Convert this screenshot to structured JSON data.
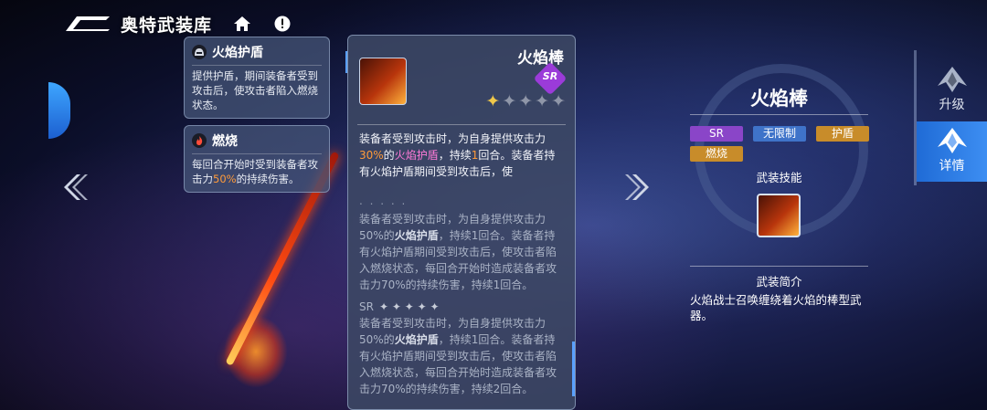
{
  "header": {
    "title": "奥特武装库"
  },
  "skills": [
    {
      "name": "火焰护盾",
      "icon": "helmet-icon",
      "desc": "提供护盾，期间装备者受到攻击后，使攻击者陷入燃烧状态。"
    },
    {
      "name": "燃烧",
      "icon": "flame-icon",
      "desc_pre": "每回合开始时受到装备者攻击力",
      "desc_pct": "50%",
      "desc_post": "的持续伤害。"
    }
  ],
  "weapon": {
    "name": "火焰棒",
    "rarity": "SR",
    "stars_total": 5,
    "stars_filled": 1,
    "effect": {
      "p1": "装备者受到攻击时，为自身提供攻击力",
      "pct": "30%",
      "p2": "的",
      "shield": "火焰护盾",
      "p3": "，持续",
      "turns": "1",
      "p4": "回合。装备者持有火焰护盾期间受到攻击后，使"
    },
    "dots": ". . . . .",
    "sub_effect_1_a": "装备者受到攻击时，为自身提供攻击力50%的",
    "sub_effect_1_b": "火焰护盾",
    "sub_effect_1_c": "，持续1回合。装备者持有火焰护盾期间受到攻击后，使攻击者陷入燃烧状态，每回合开始时造成装备者攻击力70%的持续伤害，持续1回合。",
    "sr_label": "SR",
    "sub_effect_2_a": "装备者受到攻击时，为自身提供攻击力50%的",
    "sub_effect_2_b": "火焰护盾",
    "sub_effect_2_c": "，持续1回合。装备者持有火焰护盾期间受到攻击后，使攻击者陷入燃烧状态，每回合开始时造成装备者攻击力70%的持续伤害，持续2回合。"
  },
  "detail": {
    "title": "火焰棒",
    "tags": [
      {
        "label": "SR",
        "color": "#8a45c8"
      },
      {
        "label": "无限制",
        "color": "#3f73c9"
      },
      {
        "label": "护盾",
        "color": "#c88c2a"
      },
      {
        "label": "燃烧",
        "color": "#c88c2a"
      }
    ],
    "skill_label": "武装技能",
    "intro_label": "武装简介",
    "intro": "火焰战士召唤缠绕着火焰的棒型武器。"
  },
  "side_tabs": [
    {
      "label": "升级",
      "active": false
    },
    {
      "label": "详情",
      "active": true
    }
  ],
  "colors": {
    "accent": "#3d8ef2",
    "highlight_orange": "#ff9b3a",
    "highlight_pink": "#ff7ad8",
    "rarity_sr": "#9b3bd9"
  }
}
